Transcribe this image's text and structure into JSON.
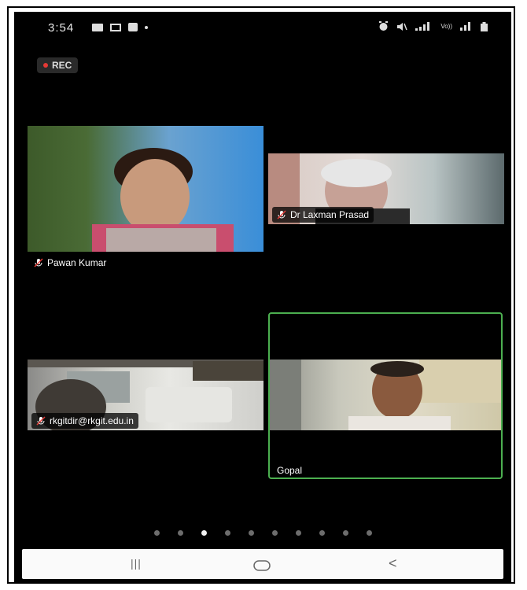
{
  "status_bar": {
    "time": "3:54",
    "icons_left": [
      "image-icon",
      "message-icon",
      "camera-icon",
      "dot-icon"
    ],
    "icons_right": [
      "alarm-icon",
      "mute-icon",
      "signal-icon",
      "battery-icon"
    ],
    "network_text": "Vo))"
  },
  "recording": {
    "label": "REC"
  },
  "participants": [
    {
      "name": "Pawan Kumar",
      "muted": true
    },
    {
      "name": "Dr Laxman Prasad",
      "muted": true
    },
    {
      "name": "rkgitdir@rkgit.edu.in",
      "muted": true
    },
    {
      "name": "Gopal",
      "active_speaker": true
    }
  ],
  "pager": {
    "count": 10,
    "active_index": 2
  },
  "nav": {
    "recents": "|||",
    "home": "○",
    "back": "<"
  },
  "colors": {
    "speaker_border": "#4caf50",
    "rec_dot": "#e53935"
  }
}
